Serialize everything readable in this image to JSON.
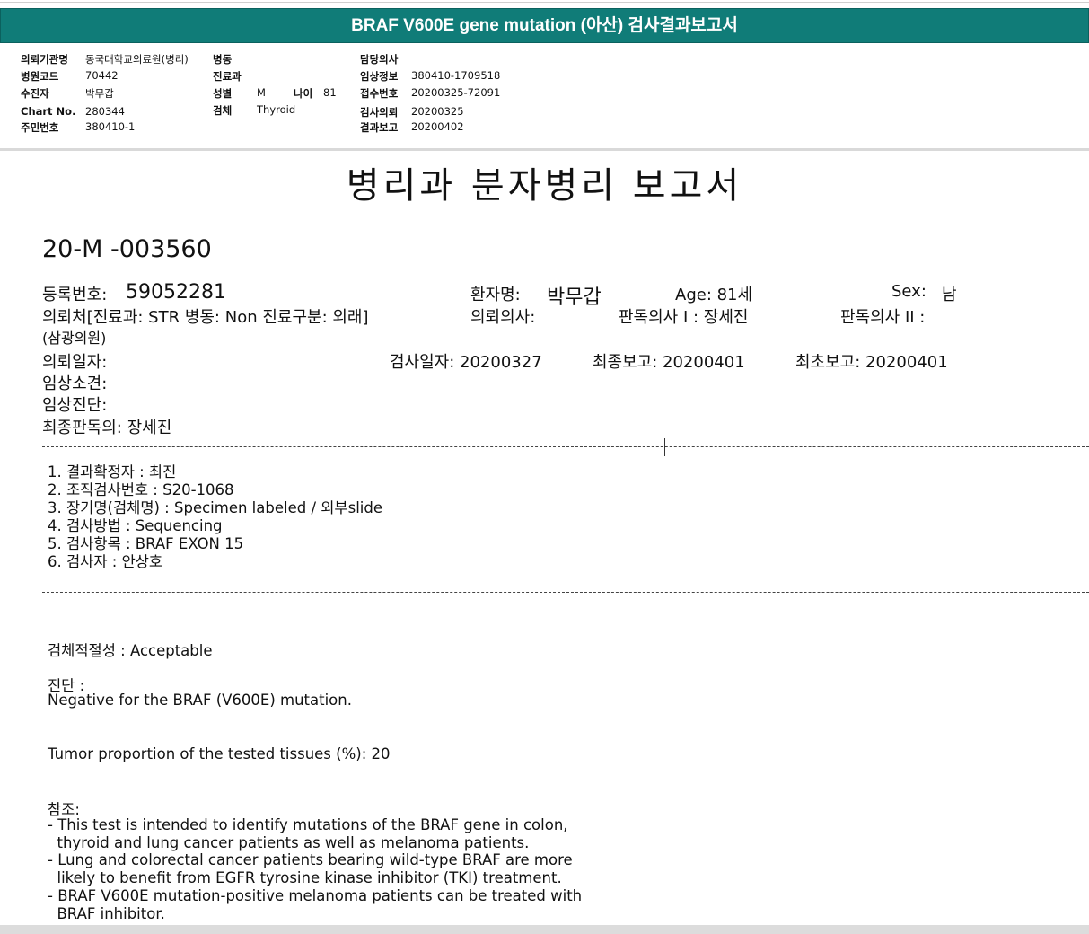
{
  "banner_title": "BRAF V600E gene mutation (아산) 검사결과보고서",
  "header": {
    "req_inst_label": "의뢰기관명",
    "req_inst_value": "동국대학교의료원(병리)",
    "hosp_code_label": "병원코드",
    "hosp_code_value": "70442",
    "patient_label": "수진자",
    "patient_value": "박무갑",
    "chart_label": "Chart No.",
    "chart_value": "280344",
    "id_label": "주민번호",
    "id_value": "380410-1",
    "ward_label": "병동",
    "dept_label": "진료과",
    "sex_label": "성별",
    "sex_value": "M",
    "age_label": "나이",
    "age_value": "81",
    "specimen_label": "검체",
    "specimen_value": "Thyroid",
    "doctor_label": "담당의사",
    "clinical_label": "임상정보",
    "clinical_value": "380410-1709518",
    "receipt_label": "접수번호",
    "receipt_value": "20200325-72091",
    "test_req_label": "검사의뢰",
    "test_req_value": "20200325",
    "result_label": "결과보고",
    "result_value": "20200402"
  },
  "report_title": "병리과 분자병리 보고서",
  "report_code": "20-M -003560",
  "fields": {
    "reg_no_label": "등록번호:",
    "reg_no_value": "59052281",
    "patient_name_label": "환자명:",
    "patient_name_value": "박무갑",
    "age_text": "Age:  81세",
    "sex_label": "Sex:",
    "sex_value": "남",
    "referral": "의뢰처[진료과: STR 병동: Non 진료구분: 외래]",
    "referral_clinic": "(삼광의원)",
    "ref_doctor": "의뢰의사:",
    "reader1": "판독의사 I : 장세진",
    "reader2": "판독의사 II :",
    "request_date": "의뢰일자:",
    "test_date": "검사일자: 20200327",
    "final_report": "최종보고: 20200401",
    "first_report": "최초보고: 20200401",
    "clinical_findings": "임상소견:",
    "clinical_diagnosis": "임상진단:",
    "final_reader": "최종판독의: 장세진"
  },
  "list": [
    "1. 결과확정자 :   최진",
    "2. 조직검사번호 : S20-1068",
    "3. 장기명(검체명) : Specimen labeled / 외부slide",
    "4. 검사방법 : Sequencing",
    "5. 검사항목 : BRAF EXON 15",
    "6. 검사자 : 안상호"
  ],
  "adequacy": "검체적절성 : Acceptable",
  "diagnosis_label": "진단 :",
  "diagnosis_text": "Negative  for  the  BRAF  (V600E)  mutation.",
  "tumor_proportion": "Tumor proportion of the tested tissues  (%): 20",
  "reference_label": "참조:",
  "reference_lines": [
    "- This test is intended to identify mutations of the BRAF gene in colon,",
    "  thyroid and lung cancer patients as well as melanoma patients.",
    "- Lung and colorectal cancer patients bearing wild-type BRAF are more",
    "  likely to benefit from EGFR tyrosine kinase inhibitor (TKI) treatment.",
    "- BRAF V600E mutation-positive melanoma patients can be treated with",
    "  BRAF inhibitor."
  ]
}
